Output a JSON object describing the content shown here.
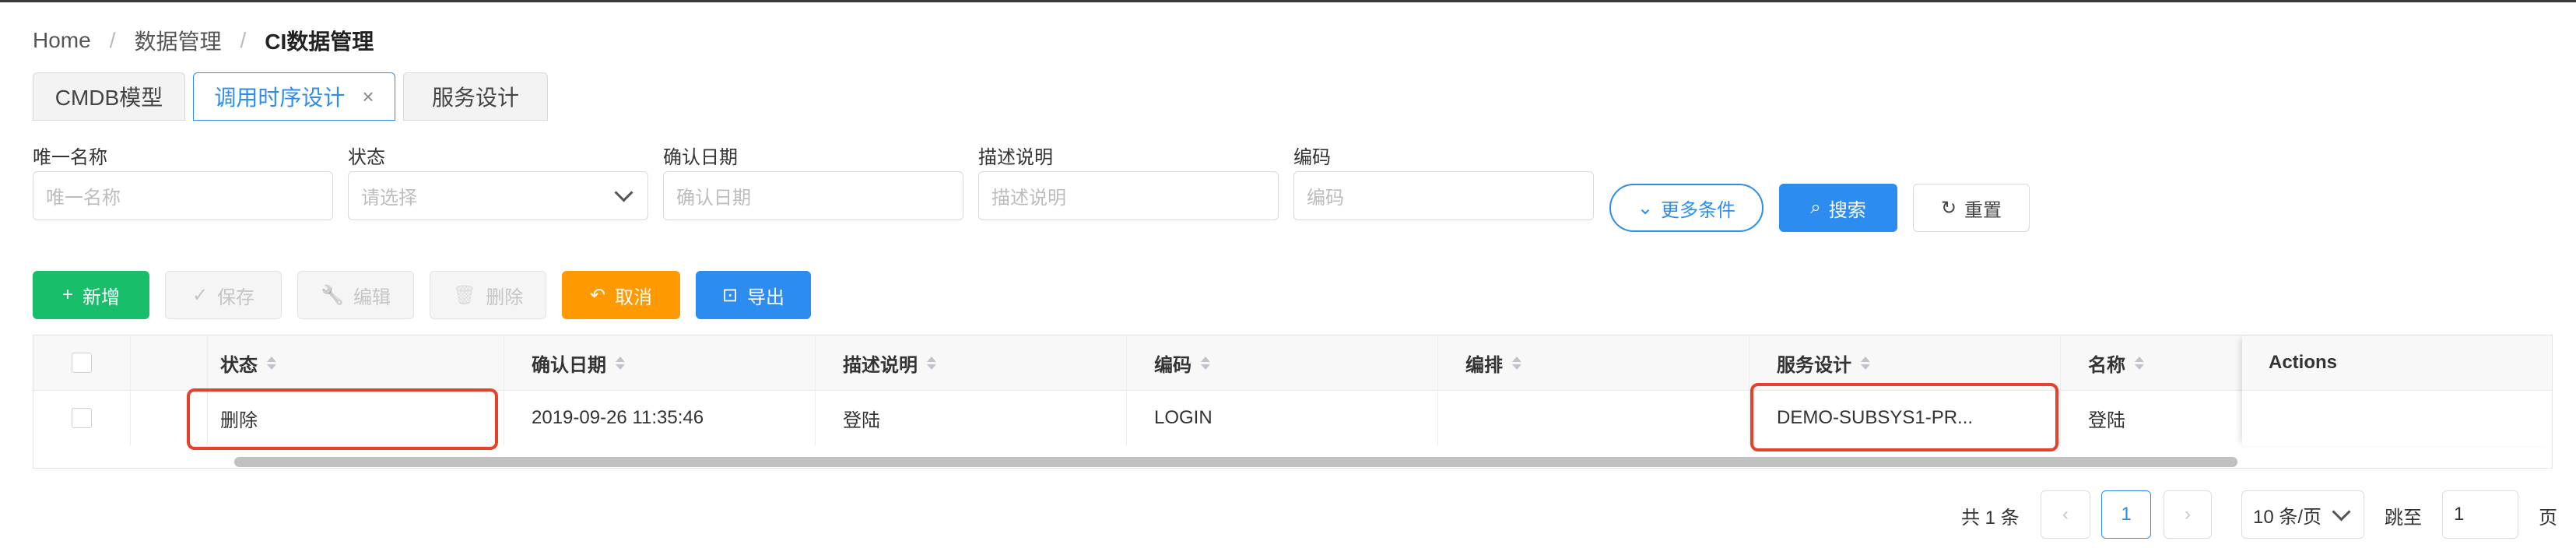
{
  "breadcrumb": {
    "home": "Home",
    "level1": "数据管理",
    "current": "CI数据管理"
  },
  "tabs": [
    {
      "label": "CMDB模型"
    },
    {
      "label": "调用时序设计",
      "close": "×"
    },
    {
      "label": "服务设计"
    }
  ],
  "filters": [
    {
      "label": "唯一名称",
      "placeholder": "唯一名称"
    },
    {
      "label": "状态",
      "placeholder": "请选择"
    },
    {
      "label": "确认日期",
      "placeholder": "确认日期"
    },
    {
      "label": "描述说明",
      "placeholder": "描述说明"
    },
    {
      "label": "编码",
      "placeholder": "编码"
    }
  ],
  "filter_buttons": {
    "more": "更多条件",
    "search": "搜索",
    "reset": "重置"
  },
  "toolbar": {
    "add": "新增",
    "save": "保存",
    "edit": "编辑",
    "delete": "删除",
    "cancel": "取消",
    "export": "导出"
  },
  "icons": {
    "plus": "+",
    "check": "✓",
    "wrench": "🔧",
    "trash": "🗑",
    "undo": "↶",
    "export": "⊡",
    "search": "⌕",
    "refresh": "↻",
    "chevron_down": "⌄"
  },
  "table": {
    "columns": [
      "状态",
      "确认日期",
      "描述说明",
      "编码",
      "编排",
      "服务设计",
      "名称",
      "Actions"
    ],
    "rows": [
      {
        "status": "删除",
        "confirm_date": "2019-09-26 11:35:46",
        "description": "登陆",
        "code": "LOGIN",
        "orchestration": "",
        "service_design": "DEMO-SUBSYS1-PR...",
        "name": "登陆",
        "actions": ""
      }
    ]
  },
  "pagination": {
    "total": "共 1 条",
    "prev": "‹",
    "page": "1",
    "next": "›",
    "page_size": "10 条/页",
    "jump_label": "跳至",
    "jump_value": "1",
    "page_suffix": "页"
  },
  "colors": {
    "primary": "#2d8cf0",
    "success": "#19be6b",
    "warning": "#ff9900",
    "highlight": "#e8412a"
  }
}
